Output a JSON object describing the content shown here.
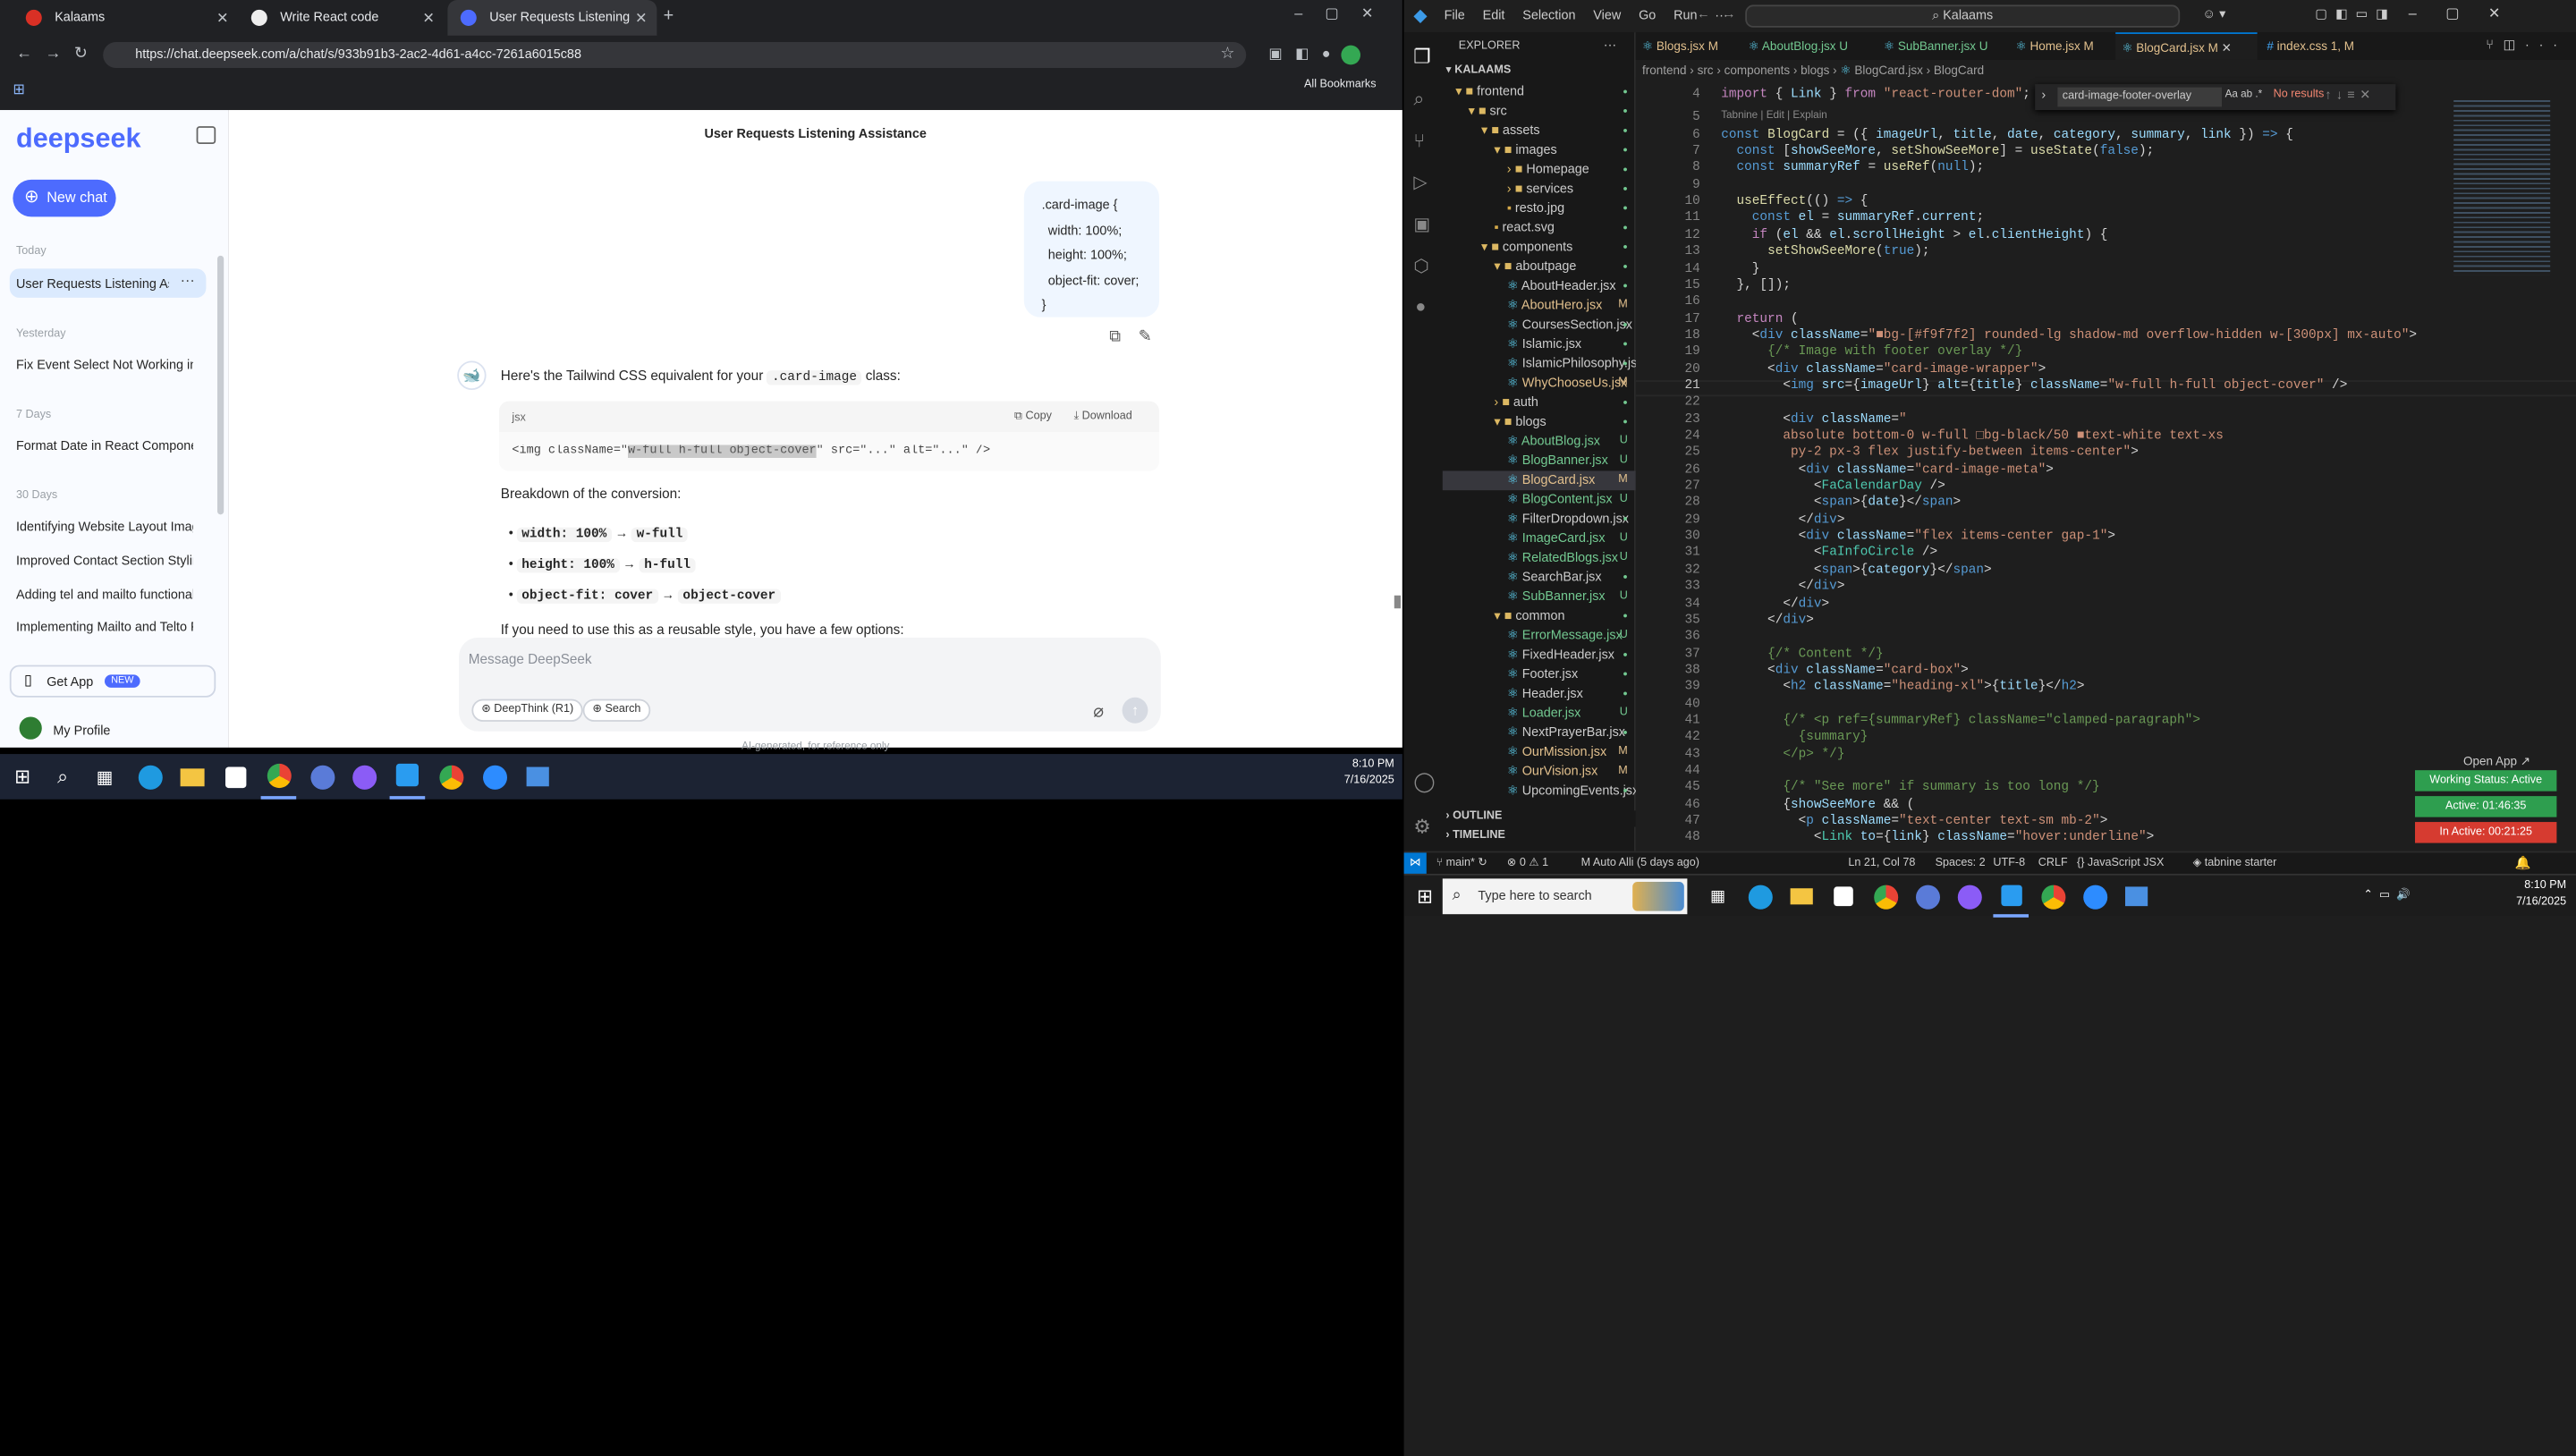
{
  "chrome": {
    "tabs": [
      {
        "title": "Kalaams"
      },
      {
        "title": "Write React code"
      },
      {
        "title": "User Requests Listening Assi"
      }
    ],
    "url": "https://chat.deepseek.com/a/chat/s/933b91b3-2ac2-4d61-a4cc-7261a6015c88",
    "bookmarks_label": "All Bookmarks"
  },
  "deepseek": {
    "logo": "deepseek",
    "new_chat": "New chat",
    "title": "User Requests Listening Assistance",
    "groups": [
      {
        "label": "Today",
        "items": [
          "User Requests Listening As"
        ]
      },
      {
        "label": "Yesterday",
        "items": [
          "Fix Event Select Not Working in F"
        ]
      },
      {
        "label": "7 Days",
        "items": [
          "Format Date in React Componen"
        ]
      },
      {
        "label": "30 Days",
        "items": [
          "Identifying Website Layout Imag",
          "Improved Contact Section Stylin",
          "Adding tel and mailto functional",
          "Implementing Mailto and Telto F"
        ]
      }
    ],
    "get_app": "Get App",
    "new_badge": "NEW",
    "profile": "My Profile",
    "user_msg": [
      ".card-image {",
      "width: 100%;",
      "height: 100%;",
      "object-fit: cover;",
      "}"
    ],
    "answer_intro_a": "Here's the Tailwind CSS equivalent for your",
    "answer_intro_code": ".card-image",
    "answer_intro_b": "class:",
    "code_lang": "jsx",
    "copy": "Copy",
    "download": "Download",
    "code_a": "<img className=\"",
    "code_hl": "w-full h-full object-cover",
    "code_b": "\" src=\"...\" alt=\"...\" />",
    "breakdown": "Breakdown of the conversion:",
    "bullets": [
      {
        "from": "width: 100%",
        "to": "w-full"
      },
      {
        "from": "height: 100%",
        "to": "h-full"
      },
      {
        "from": "object-fit: cover",
        "to": "object-cover"
      }
    ],
    "arrow": "→",
    "more": "If you need to use this as a reusable style, you have a few options:",
    "placeholder": "Message DeepSeek",
    "deepthink": "DeepThink (R1)",
    "search": "Search",
    "disclaimer": "AI-generated, for reference only"
  },
  "taskbar_left": {
    "time": "8:10 PM",
    "date": "7/16/2025"
  },
  "vscode": {
    "menu": [
      "File",
      "Edit",
      "Selection",
      "View",
      "Go",
      "Run",
      "···"
    ],
    "search": "Kalaams",
    "explorer": "EXPLORER",
    "root": "KALAAMS",
    "tabs": [
      {
        "name": "Blogs.jsx",
        "flag": "M"
      },
      {
        "name": "AboutBlog.jsx",
        "flag": "U"
      },
      {
        "name": "SubBanner.jsx",
        "flag": "U"
      },
      {
        "name": "Home.jsx",
        "flag": "M"
      },
      {
        "name": "BlogCard.jsx",
        "flag": "M"
      },
      {
        "name": "index.css",
        "flag": "1, M"
      }
    ],
    "breadcrumb": [
      "frontend",
      "src",
      "components",
      "blogs",
      "BlogCard.jsx",
      "BlogCard"
    ],
    "find_value": "card-image-footer-overlay",
    "find_result": "No results",
    "codelens": "Tabnine | Edit | Explain",
    "tree": [
      {
        "n": "frontend",
        "d": 1,
        "t": "o"
      },
      {
        "n": "src",
        "d": 2,
        "t": "o"
      },
      {
        "n": "assets",
        "d": 3,
        "t": "o"
      },
      {
        "n": "images",
        "d": 4,
        "t": "o"
      },
      {
        "n": "Homepage",
        "d": 5,
        "t": "c"
      },
      {
        "n": "services",
        "d": 5,
        "t": "c"
      },
      {
        "n": "resto.jpg",
        "d": 5,
        "t": "f"
      },
      {
        "n": "react.svg",
        "d": 4,
        "t": "f"
      },
      {
        "n": "components",
        "d": 3,
        "t": "o"
      },
      {
        "n": "aboutpage",
        "d": 4,
        "t": "o"
      },
      {
        "n": "AboutHeader.jsx",
        "d": 5,
        "t": "f"
      },
      {
        "n": "AboutHero.jsx",
        "d": 5,
        "t": "f",
        "b": "M"
      },
      {
        "n": "CoursesSection.jsx",
        "d": 5,
        "t": "f"
      },
      {
        "n": "Islamic.jsx",
        "d": 5,
        "t": "f"
      },
      {
        "n": "IslamicPhilosophy.jsx",
        "d": 5,
        "t": "f"
      },
      {
        "n": "WhyChooseUs.jsx",
        "d": 5,
        "t": "f",
        "b": "M"
      },
      {
        "n": "auth",
        "d": 4,
        "t": "c"
      },
      {
        "n": "blogs",
        "d": 4,
        "t": "o"
      },
      {
        "n": "AboutBlog.jsx",
        "d": 5,
        "t": "f",
        "b": "U"
      },
      {
        "n": "BlogBanner.jsx",
        "d": 5,
        "t": "f",
        "b": "U"
      },
      {
        "n": "BlogCard.jsx",
        "d": 5,
        "t": "f",
        "b": "M",
        "sel": true
      },
      {
        "n": "BlogContent.jsx",
        "d": 5,
        "t": "f",
        "b": "U"
      },
      {
        "n": "FilterDropdown.jsx",
        "d": 5,
        "t": "f"
      },
      {
        "n": "ImageCard.jsx",
        "d": 5,
        "t": "f",
        "b": "U"
      },
      {
        "n": "RelatedBlogs.jsx",
        "d": 5,
        "t": "f",
        "b": "U"
      },
      {
        "n": "SearchBar.jsx",
        "d": 5,
        "t": "f"
      },
      {
        "n": "SubBanner.jsx",
        "d": 5,
        "t": "f",
        "b": "U"
      },
      {
        "n": "common",
        "d": 4,
        "t": "o"
      },
      {
        "n": "ErrorMessage.jsx",
        "d": 5,
        "t": "f",
        "b": "U"
      },
      {
        "n": "FixedHeader.jsx",
        "d": 5,
        "t": "f"
      },
      {
        "n": "Footer.jsx",
        "d": 5,
        "t": "f"
      },
      {
        "n": "Header.jsx",
        "d": 5,
        "t": "f"
      },
      {
        "n": "Loader.jsx",
        "d": 5,
        "t": "f",
        "b": "U"
      },
      {
        "n": "NextPrayerBar.jsx",
        "d": 5,
        "t": "f"
      },
      {
        "n": "OurMission.jsx",
        "d": 5,
        "t": "f",
        "b": "M"
      },
      {
        "n": "OurVision.jsx",
        "d": 5,
        "t": "f",
        "b": "M"
      },
      {
        "n": "UpcomingEvents.jsx",
        "d": 5,
        "t": "f"
      }
    ],
    "outline": "OUTLINE",
    "timeline": "TIMELINE",
    "code": [
      {
        "n": "4",
        "h": "<span class='k'>import</span> { <span class='v'>Link</span> } <span class='k'>from</span> <span class='s'>\"react-router-dom\"</span>;"
      },
      {
        "n": "5",
        "h": ""
      },
      {
        "n": "6",
        "h": "<span class='t'>const</span> <span class='f'>BlogCard</span> = ({ <span class='v'>imageUrl</span>, <span class='v'>title</span>, <span class='v'>date</span>, <span class='v'>category</span>, <span class='v'>summary</span>, <span class='v'>link</span> }) <span class='t'>=&gt;</span> {"
      },
      {
        "n": "7",
        "h": "  <span class='t'>const</span> [<span class='v'>showSeeMore</span>, <span class='f'>setShowSeeMore</span>] = <span class='f'>useState</span>(<span class='t'>false</span>);"
      },
      {
        "n": "8",
        "h": "  <span class='t'>const</span> <span class='v'>summaryRef</span> = <span class='f'>useRef</span>(<span class='t'>null</span>);"
      },
      {
        "n": "9",
        "h": ""
      },
      {
        "n": "10",
        "h": "  <span class='f'>useEffect</span>(() <span class='t'>=&gt;</span> {"
      },
      {
        "n": "11",
        "h": "    <span class='t'>const</span> <span class='v'>el</span> = <span class='v'>summaryRef</span>.<span class='v'>current</span>;"
      },
      {
        "n": "12",
        "h": "    <span class='k'>if</span> (<span class='v'>el</span> &amp;&amp; <span class='v'>el</span>.<span class='v'>scrollHeight</span> &gt; <span class='v'>el</span>.<span class='v'>clientHeight</span>) {"
      },
      {
        "n": "13",
        "h": "      <span class='f'>setShowSeeMore</span>(<span class='t'>true</span>);"
      },
      {
        "n": "14",
        "h": "    }"
      },
      {
        "n": "15",
        "h": "  }, []);"
      },
      {
        "n": "16",
        "h": ""
      },
      {
        "n": "17",
        "h": "  <span class='k'>return</span> ("
      },
      {
        "n": "18",
        "h": "    &lt;<span class='t'>div</span> <span class='v'>className</span>=<span class='s'>\"■bg-[#f9f7f2] rounded-lg shadow-md overflow-hidden w-[300px] mx-auto\"</span>&gt;"
      },
      {
        "n": "19",
        "h": "      <span class='c'>{/* Image with footer overlay */}</span>"
      },
      {
        "n": "20",
        "h": "      &lt;<span class='t'>div</span> <span class='v'>className</span>=<span class='s'>\"card-image-wrapper\"</span>&gt;"
      },
      {
        "n": "21",
        "h": "        &lt;<span class='t'>img</span> <span class='v'>src</span>={<span class='v'>imageUrl</span>} <span class='v'>alt</span>={<span class='v'>title</span>} <span class='v'>className</span>=<span class='s'>\"w-full h-full object-cover\"</span> /&gt;"
      },
      {
        "n": "22",
        "h": ""
      },
      {
        "n": "23",
        "h": "        &lt;<span class='t'>div</span> <span class='v'>className</span>=<span class='s'>\"</span>"
      },
      {
        "n": "24",
        "h": "<span class='s'>        absolute bottom-0 w-full □bg-black/50 ■text-white text-xs</span>"
      },
      {
        "n": "25",
        "h": "<span class='s'>         py-2 px-3 flex justify-between items-center\"</span>&gt;"
      },
      {
        "n": "26",
        "h": "          &lt;<span class='t'>div</span> <span class='v'>className</span>=<span class='s'>\"card-image-meta\"</span>&gt;"
      },
      {
        "n": "27",
        "h": "            &lt;<span class='g'>FaCalendarDay</span> /&gt;"
      },
      {
        "n": "28",
        "h": "            &lt;<span class='t'>span</span>&gt;{<span class='v'>date</span>}&lt;/<span class='t'>span</span>&gt;"
      },
      {
        "n": "29",
        "h": "          &lt;/<span class='t'>div</span>&gt;"
      },
      {
        "n": "30",
        "h": "          &lt;<span class='t'>div</span> <span class='v'>className</span>=<span class='s'>\"flex items-center gap-1\"</span>&gt;"
      },
      {
        "n": "31",
        "h": "            &lt;<span class='g'>FaInfoCircle</span> /&gt;"
      },
      {
        "n": "32",
        "h": "            &lt;<span class='t'>span</span>&gt;{<span class='v'>category</span>}&lt;/<span class='t'>span</span>&gt;"
      },
      {
        "n": "33",
        "h": "          &lt;/<span class='t'>div</span>&gt;"
      },
      {
        "n": "34",
        "h": "        &lt;/<span class='t'>div</span>&gt;"
      },
      {
        "n": "35",
        "h": "      &lt;/<span class='t'>div</span>&gt;"
      },
      {
        "n": "36",
        "h": ""
      },
      {
        "n": "37",
        "h": "      <span class='c'>{/* Content */}</span>"
      },
      {
        "n": "38",
        "h": "      &lt;<span class='t'>div</span> <span class='v'>className</span>=<span class='s'>\"card-box\"</span>&gt;"
      },
      {
        "n": "39",
        "h": "        &lt;<span class='t'>h2</span> <span class='v'>className</span>=<span class='s'>\"heading-xl\"</span>&gt;{<span class='v'>title</span>}&lt;/<span class='t'>h2</span>&gt;"
      },
      {
        "n": "40",
        "h": ""
      },
      {
        "n": "41",
        "h": "        <span class='c'>{/* &lt;p ref={summaryRef} className=\"clamped-paragraph\"&gt;</span>"
      },
      {
        "n": "42",
        "h": "<span class='c'>          {summary}</span>"
      },
      {
        "n": "43",
        "h": "<span class='c'>        &lt;/p&gt; */}</span>"
      },
      {
        "n": "44",
        "h": ""
      },
      {
        "n": "45",
        "h": "        <span class='c'>{/* \"See more\" if summary is too long */}</span>"
      },
      {
        "n": "46",
        "h": "        {<span class='v'>showSeeMore</span> &amp;&amp; ("
      },
      {
        "n": "47",
        "h": "          &lt;<span class='t'>p</span> <span class='v'>className</span>=<span class='s'>\"text-center text-sm mb-2\"</span>&gt;"
      },
      {
        "n": "48",
        "h": "            &lt;<span class='g'>Link</span> <span class='v'>to</span>={<span class='v'>link</span>} <span class='v'>className</span>=<span class='s'>\"hover:underline\"</span>&gt;"
      }
    ],
    "status": {
      "branch": "main*",
      "errors": "⊗ 0 ⚠ 1",
      "extra": "M Auto Alli (5 days ago)",
      "pos": "Ln 21, Col 78",
      "spaces": "Spaces: 2",
      "enc": "UTF-8",
      "eol": "CRLF",
      "lang": "{} JavaScript JSX",
      "tabnine": "tabnine starter"
    },
    "open_app": "Open App ↗",
    "work": [
      {
        "label": "Working Status: Active",
        "color": "#2e9e4f"
      },
      {
        "label": "Active: 01:46:35",
        "color": "#2e9e4f"
      },
      {
        "label": "In Active: 00:21:25",
        "color": "#d63b30"
      }
    ]
  },
  "taskbar": {
    "search": "Type here to search",
    "time": "8:10 PM",
    "date": "7/16/2025"
  }
}
